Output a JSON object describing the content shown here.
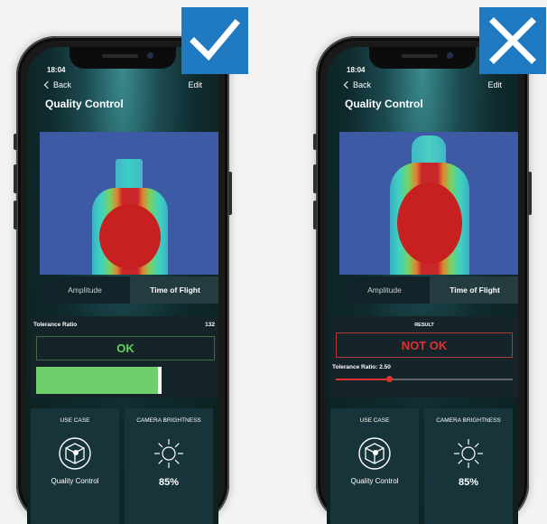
{
  "left_phone": {
    "time": "18:04",
    "back_label": "Back",
    "edit_label": "Edit",
    "title": "Quality Control",
    "tabs": [
      {
        "label": "Amplitude",
        "active": false
      },
      {
        "label": "Time of Flight",
        "active": true
      }
    ],
    "tolerance_label": "Tolerance Ratio",
    "tolerance_value": "132",
    "result_text": "OK",
    "result_color": "#64d060",
    "progress_fraction": 0.7,
    "use_case_title": "USE CASE",
    "use_case_label": "Quality Control",
    "brightness_title": "CAMERA BRIGHTNESS",
    "brightness_value": "85%"
  },
  "right_phone": {
    "time": "18:04",
    "back_label": "Back",
    "edit_label": "Edit",
    "title": "Quality Control",
    "tabs": [
      {
        "label": "Amplitude",
        "active": false
      },
      {
        "label": "Time of Flight",
        "active": true
      }
    ],
    "result_label": "RESULT",
    "result_text": "NOT OK",
    "result_color": "#e03232",
    "tolerance_label": "Tolerance Ratio: 2.50",
    "slider_fraction": 0.3,
    "use_case_title": "USE CASE",
    "use_case_label": "Quality Control",
    "brightness_title": "CAMERA BRIGHTNESS",
    "brightness_value": "85%"
  },
  "badges": {
    "left_icon": "checkmark-icon",
    "right_icon": "x-icon",
    "color": "#1f7ac2"
  }
}
